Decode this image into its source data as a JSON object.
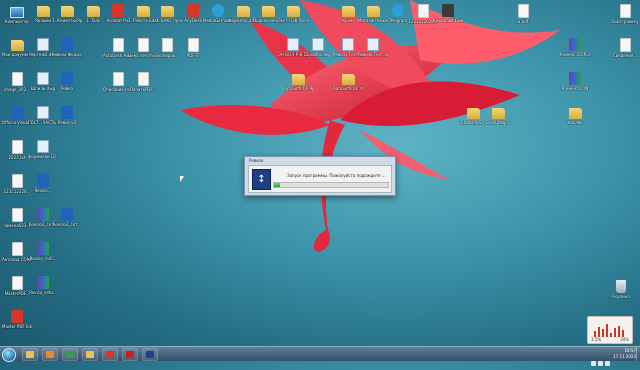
{
  "desktop": {
    "icons": [
      {
        "label": "Компьютер",
        "kind": "pc",
        "pos": [
          2,
          4
        ]
      },
      {
        "label": "Ярлыки",
        "kind": "folder",
        "pos": [
          28,
          4
        ]
      },
      {
        "label": "1. Клиенты/Ярлык",
        "kind": "folder",
        "pos": [
          52,
          4
        ]
      },
      {
        "label": "1. Task",
        "kind": "folder",
        "pos": [
          78,
          4
        ]
      },
      {
        "label": "Acrobat Pro",
        "kind": "app-red",
        "pos": [
          103,
          4
        ]
      },
      {
        "label": "1. Работа БАКС",
        "kind": "folder",
        "pos": [
          128,
          4
        ]
      },
      {
        "label": "1.1. БАКС программ...",
        "kind": "folder",
        "pos": [
          152,
          4
        ]
      },
      {
        "label": "AnyDesk",
        "kind": "app-red",
        "pos": [
          178,
          4
        ]
      },
      {
        "label": "MediaGet Video Con...",
        "kind": "app-teal",
        "pos": [
          203,
          4
        ]
      },
      {
        "label": "Форматы для КТ",
        "kind": "folder",
        "pos": [
          228,
          4
        ]
      },
      {
        "label": "Подключения к удален...",
        "kind": "folder",
        "pos": [
          253,
          4
        ]
      },
      {
        "label": "Тест-ПЭВ Ярлык",
        "kind": "folder",
        "pos": [
          278,
          4
        ]
      },
      {
        "label": "Крым",
        "kind": "folder",
        "pos": [
          333,
          4
        ]
      },
      {
        "label": "Магазин Ключи",
        "kind": "folder",
        "pos": [
          358,
          4
        ]
      },
      {
        "label": "Telegram",
        "kind": "app-teal",
        "pos": [
          383,
          4
        ]
      },
      {
        "label": "1231222029...",
        "kind": "doc",
        "pos": [
          408,
          4
        ]
      },
      {
        "label": "Кириллов Дмитрий",
        "kind": "app-dark",
        "pos": [
          433,
          4
        ]
      },
      {
        "label": "ц.pdf",
        "kind": "doc",
        "pos": [
          508,
          4
        ]
      },
      {
        "label": "Dolch Jewelry",
        "kind": "doc",
        "pos": [
          610,
          4
        ]
      },
      {
        "label": "Мои документ...",
        "kind": "folder",
        "pos": [
          2,
          38
        ]
      },
      {
        "label": "Чертеж4.dwg",
        "kind": "dwg",
        "pos": [
          28,
          38
        ]
      },
      {
        "label": "Ревизо Формат",
        "kind": "app-blue",
        "pos": [
          52,
          38
        ]
      },
      {
        "label": "AutoDesk Навигатор...",
        "kind": "doc",
        "pos": [
          103,
          38
        ]
      },
      {
        "label": "Цена печати ктслова",
        "kind": "doc",
        "pos": [
          128,
          38
        ]
      },
      {
        "label": "Скопиров...",
        "kind": "doc",
        "pos": [
          152,
          38
        ]
      },
      {
        "label": "PDF-Tr",
        "kind": "doc",
        "pos": [
          178,
          38
        ]
      },
      {
        "label": "ЭН-ВОЛ-Р-В 123120...",
        "kind": "dwg",
        "pos": [
          278,
          38
        ]
      },
      {
        "label": "Пройба.dwg",
        "kind": "dwg",
        "pos": [
          303,
          38
        ]
      },
      {
        "label": "Ревизо Тест.dwg",
        "kind": "dwg",
        "pos": [
          333,
          38
        ]
      },
      {
        "label": "Ревизо Тест.dwg",
        "kind": "dwg",
        "pos": [
          358,
          38
        ]
      },
      {
        "label": "Клиенс ICON.zip",
        "kind": "winrar",
        "pos": [
          560,
          38
        ]
      },
      {
        "label": "Сведения...",
        "kind": "doc",
        "pos": [
          610,
          38
        ]
      },
      {
        "label": "image_202...",
        "kind": "doc",
        "pos": [
          2,
          72
        ]
      },
      {
        "label": "Шпили.dwg",
        "kind": "dwg",
        "pos": [
          28,
          72
        ]
      },
      {
        "label": "Ревиз",
        "kind": "app-blue",
        "pos": [
          52,
          72
        ]
      },
      {
        "label": "Описание по архив...",
        "kind": "doc",
        "pos": [
          103,
          72
        ]
      },
      {
        "label": "ПечатьPDF...",
        "kind": "doc",
        "pos": [
          128,
          72
        ]
      },
      {
        "label": "AutoSoftPDF Ярлык",
        "kind": "folder",
        "pos": [
          283,
          72
        ]
      },
      {
        "label": "AutoSoftPDF тест PDF",
        "kind": "folder",
        "pos": [
          333,
          72
        ]
      },
      {
        "label": "Клиенс ICON",
        "kind": "winrar",
        "pos": [
          560,
          72
        ]
      },
      {
        "label": "Official Visual MS...",
        "kind": "app-blue",
        "pos": [
          2,
          106
        ]
      },
      {
        "label": "ГОСТ...ЧАСТЬ К15...",
        "kind": "dwg",
        "pos": [
          28,
          106
        ]
      },
      {
        "label": "Ревиз v3",
        "kind": "app-blue",
        "pos": [
          52,
          106
        ]
      },
      {
        "label": "ClishUPDS...",
        "kind": "folder",
        "pos": [
          458,
          106
        ]
      },
      {
        "label": "ClishUMop...",
        "kind": "folder",
        "pos": [
          483,
          106
        ]
      },
      {
        "label": "масляк",
        "kind": "folder",
        "pos": [
          560,
          106
        ]
      },
      {
        "label": "2023.txt",
        "kind": "doc",
        "pos": [
          2,
          140
        ]
      },
      {
        "label": "формилки (2).dwg",
        "kind": "dwg",
        "pos": [
          28,
          140
        ]
      },
      {
        "label": "123212220...",
        "kind": "doc",
        "pos": [
          2,
          174
        ]
      },
      {
        "label": "Revizo...",
        "kind": "app-blue",
        "pos": [
          28,
          174
        ]
      },
      {
        "label": "заменa023...",
        "kind": "doc",
        "pos": [
          2,
          208
        ]
      },
      {
        "label": "Revizo3_сет...",
        "kind": "winrar",
        "pos": [
          28,
          208
        ]
      },
      {
        "label": "Revizo3_сет...",
        "kind": "app-blue",
        "pos": [
          52,
          208
        ]
      },
      {
        "label": "Автоход СОМАБ",
        "kind": "doc",
        "pos": [
          2,
          242
        ]
      },
      {
        "label": "Revizo_raiti...",
        "kind": "winrar",
        "pos": [
          28,
          242
        ]
      },
      {
        "label": "MasterPDF...",
        "kind": "doc",
        "pos": [
          2,
          276
        ]
      },
      {
        "label": "Revizo_setu...",
        "kind": "winrar",
        "pos": [
          28,
          276
        ]
      },
      {
        "label": "Корзина",
        "kind": "bin",
        "pos": [
          606,
          280
        ]
      },
      {
        "label": "Master PDF Editor 5.8.3...",
        "kind": "app-red",
        "pos": [
          2,
          310
        ]
      }
    ]
  },
  "dialog": {
    "title": "Ревизо",
    "message": "Запуск программы. Пожалуйста подождите ...",
    "progress_percent": 5
  },
  "gadget": {
    "cpu": "3.5%",
    "mem": "34%",
    "bars": [
      40,
      70,
      55,
      90,
      30,
      65,
      80,
      50
    ]
  },
  "taskbar": {
    "buttons": [
      {
        "name": "explorer-button",
        "color": "#e8c45a"
      },
      {
        "name": "media-player-button",
        "color": "#f0862a"
      },
      {
        "name": "chrome-button",
        "color": "#2ea34a"
      },
      {
        "name": "folder-button",
        "color": "#e8c45a"
      },
      {
        "name": "yandex-button",
        "color": "#d8352a"
      },
      {
        "name": "autocad-button",
        "color": "#c91f1f"
      },
      {
        "name": "revizo-button",
        "color": "#1d3f86"
      }
    ],
    "time": "10:57",
    "date": "17.11.2023"
  }
}
